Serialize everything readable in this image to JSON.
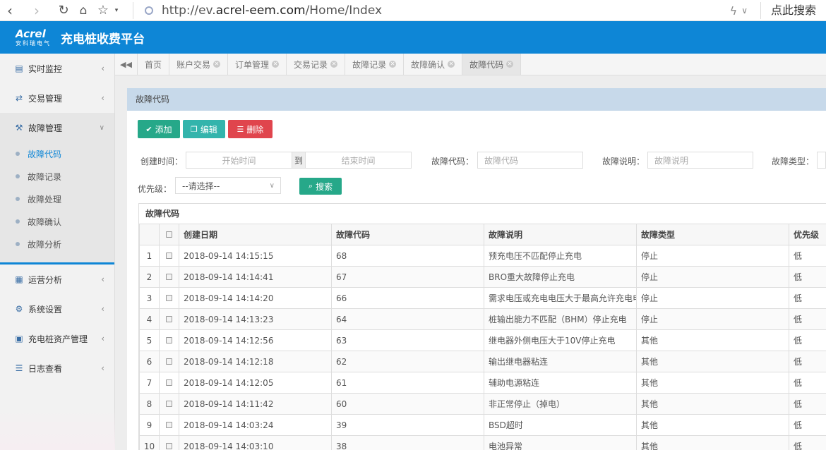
{
  "browser": {
    "url_prefix": "http://ev.",
    "url_domain": "acrel-eem.com",
    "url_path": "/Home/Index",
    "search_link": "点此搜索"
  },
  "header": {
    "logo_main": "Acrel",
    "logo_sub": "安科瑞电气",
    "title": "充电桩收费平台",
    "accent_color": "#0e86d6"
  },
  "sidebar": {
    "items": [
      {
        "label": "实时监控",
        "icon": "monitor-icon"
      },
      {
        "label": "交易管理",
        "icon": "exchange-icon"
      },
      {
        "label": "故障管理",
        "icon": "wrench-icon"
      },
      {
        "label": "运营分析",
        "icon": "calendar-icon"
      },
      {
        "label": "系统设置",
        "icon": "gear-icon"
      },
      {
        "label": "充电桩资产管理",
        "icon": "charger-icon"
      },
      {
        "label": "日志查看",
        "icon": "log-icon"
      }
    ],
    "sub_items": [
      "故障代码",
      "故障记录",
      "故障处理",
      "故障确认",
      "故障分析"
    ]
  },
  "tabs": [
    "首页",
    "账户交易",
    "订单管理",
    "交易记录",
    "故障记录",
    "故障确认",
    "故障代码"
  ],
  "panel": {
    "title": "故障代码",
    "buttons": {
      "add": "添加",
      "edit": "编辑",
      "delete": "删除",
      "search": "搜索"
    }
  },
  "filters": {
    "create_time_label": "创建时间：",
    "start_placeholder": "开始时间",
    "to": "到",
    "end_placeholder": "结束时间",
    "code_label": "故障代码：",
    "code_placeholder": "故障代码",
    "desc_label": "故障说明：",
    "desc_placeholder": "故障说明",
    "type_label": "故障类型：",
    "priority_label": "优先级：",
    "priority_value": "--请选择--"
  },
  "table": {
    "title": "故障代码",
    "headers": [
      "创建日期",
      "故障代码",
      "故障说明",
      "故障类型",
      "优先级"
    ],
    "rows": [
      {
        "n": "1",
        "date": "2018-09-14 14:15:15",
        "code": "68",
        "desc": "预充电压不匹配停止充电",
        "type": "停止",
        "priority": "低"
      },
      {
        "n": "2",
        "date": "2018-09-14 14:14:41",
        "code": "67",
        "desc": "BRO重大故障停止充电",
        "type": "停止",
        "priority": "低"
      },
      {
        "n": "3",
        "date": "2018-09-14 14:14:20",
        "code": "66",
        "desc": "需求电压或充电电压大于最高允许充电电",
        "type": "停止",
        "priority": "低"
      },
      {
        "n": "4",
        "date": "2018-09-14 14:13:23",
        "code": "64",
        "desc": "桩输出能力不匹配（BHM）停止充电",
        "type": "停止",
        "priority": "低"
      },
      {
        "n": "5",
        "date": "2018-09-14 14:12:56",
        "code": "63",
        "desc": "继电器外侧电压大于10V停止充电",
        "type": "其他",
        "priority": "低"
      },
      {
        "n": "6",
        "date": "2018-09-14 14:12:18",
        "code": "62",
        "desc": "输出继电器粘连",
        "type": "其他",
        "priority": "低"
      },
      {
        "n": "7",
        "date": "2018-09-14 14:12:05",
        "code": "61",
        "desc": "辅助电源粘连",
        "type": "其他",
        "priority": "低"
      },
      {
        "n": "8",
        "date": "2018-09-14 14:11:42",
        "code": "60",
        "desc": "非正常停止（掉电）",
        "type": "其他",
        "priority": "低"
      },
      {
        "n": "9",
        "date": "2018-09-14 14:03:24",
        "code": "39",
        "desc": "BSD超时",
        "type": "其他",
        "priority": "低"
      },
      {
        "n": "10",
        "date": "2018-09-14 14:03:10",
        "code": "38",
        "desc": "电池异常",
        "type": "其他",
        "priority": "低"
      }
    ]
  }
}
